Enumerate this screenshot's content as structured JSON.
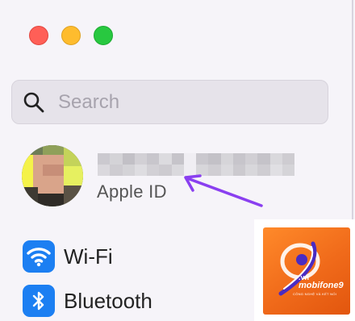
{
  "search": {
    "placeholder": "Search"
  },
  "account": {
    "label": "Apple ID"
  },
  "sidebar": {
    "items": [
      {
        "label": "Wi-Fi",
        "icon": "wifi-icon"
      },
      {
        "label": "Bluetooth",
        "icon": "bluetooth-icon"
      }
    ]
  },
  "watermark": {
    "brand": "mobifone9",
    "domain": ".vn",
    "tagline": "CÔNG NGHỆ VÀ KẾT NỐI"
  },
  "colors": {
    "accent": "#1c7ff2",
    "arrow": "#8a3ff0",
    "watermark": "#f06a1a"
  }
}
